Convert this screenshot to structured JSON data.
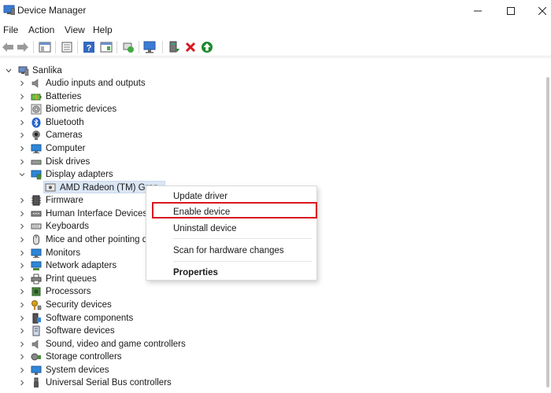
{
  "window": {
    "title": "Device Manager",
    "controls": {
      "minimize": "minimize-icon",
      "maximize": "maximize-icon",
      "close": "close-icon"
    }
  },
  "menubar": {
    "items": [
      "File",
      "Action",
      "View",
      "Help"
    ]
  },
  "toolbar": {
    "buttons": [
      "back-arrow-icon",
      "forward-arrow-icon",
      "show-hide-console-tree-icon",
      "properties-icon",
      "help-icon",
      "view-icon",
      "update-driver-icon",
      "scan-hardware-icon",
      "add-legacy-hardware-icon",
      "uninstall-device-icon",
      "enable-device-icon"
    ]
  },
  "tree": {
    "root": "Sanlika",
    "items": [
      "Audio inputs and outputs",
      "Batteries",
      "Biometric devices",
      "Bluetooth",
      "Cameras",
      "Computer",
      "Disk drives",
      "Display adapters",
      "AMD Radeon (TM) Grap",
      "Firmware",
      "Human Interface Devices",
      "Keyboards",
      "Mice and other pointing d",
      "Monitors",
      "Network adapters",
      "Print queues",
      "Processors",
      "Security devices",
      "Software components",
      "Software devices",
      "Sound, video and game controllers",
      "Storage controllers",
      "System devices",
      "Universal Serial Bus controllers"
    ]
  },
  "context_menu": {
    "items": [
      "Update driver",
      "Enable device",
      "Uninstall device",
      "Scan for hardware changes",
      "Properties"
    ],
    "highlighted": "Enable device",
    "highlight_color": "#d9161e"
  }
}
